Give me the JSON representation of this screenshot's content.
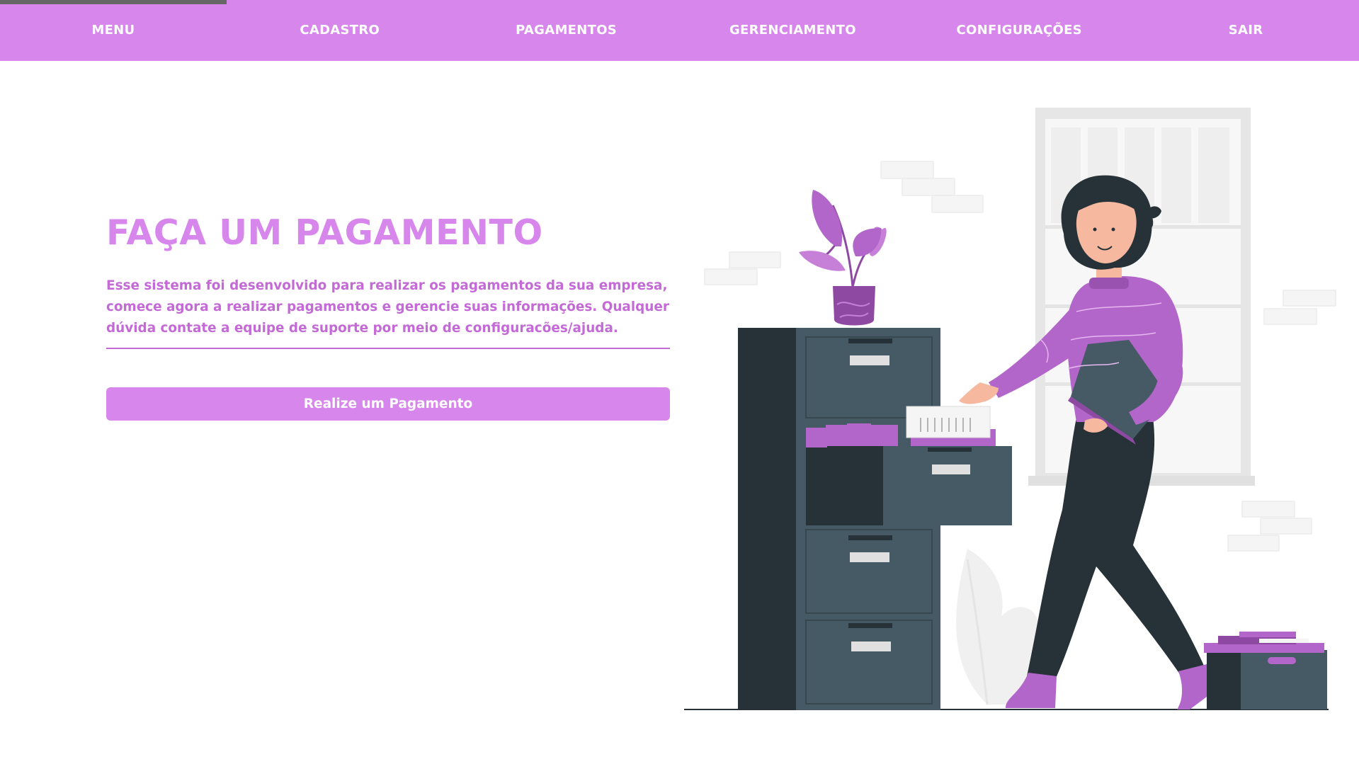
{
  "nav": {
    "items": [
      {
        "label": "MENU"
      },
      {
        "label": "CADASTRO"
      },
      {
        "label": "PAGAMENTOS"
      },
      {
        "label": "GERENCIAMENTO"
      },
      {
        "label": "CONFIGURAÇÕES"
      },
      {
        "label": "SAIR"
      }
    ]
  },
  "hero": {
    "title": "FAÇA UM PAGAMENTO",
    "description": "Esse sistema foi desenvolvido para realizar os pagamentos da sua empresa, comece agora a realizar pagamentos e gerencie suas informações. Qualquer dúvida contate a equipe de suporte por meio de configuracões/ajuda.",
    "button_label": "Realize um Pagamento"
  },
  "colors": {
    "accent": "#d787ec",
    "accent_dark": "#c36ad6",
    "cabinet": "#455a64",
    "cabinet_dark": "#263238"
  },
  "illustration": {
    "subject": "woman-filing-documents-illustration"
  }
}
